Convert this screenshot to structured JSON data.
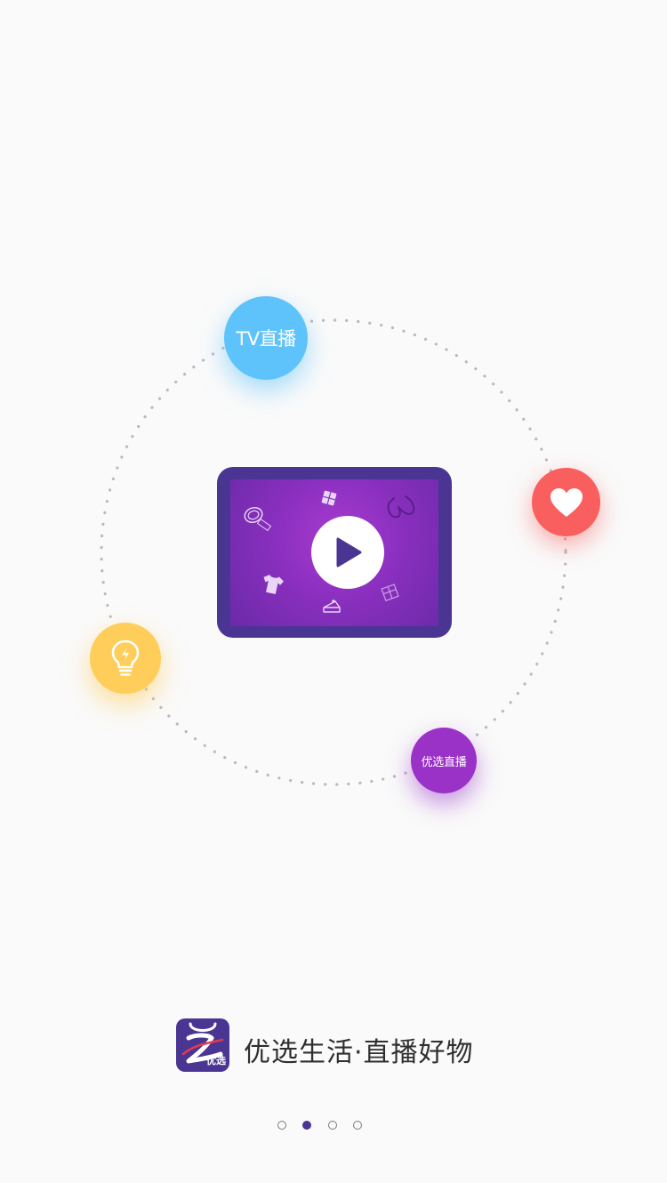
{
  "bubbles": {
    "tv_live": "TV直播",
    "selected_live": "优选直播"
  },
  "icons": {
    "heart": "heart-icon",
    "bulb": "lightbulb-icon",
    "play": "play-icon"
  },
  "logo": {
    "tag": "优选"
  },
  "slogan": "优选生活·直播好物",
  "pagination": {
    "total": 4,
    "active_index": 1
  },
  "colors": {
    "brand_purple": "#4b3593",
    "tv_bubble": "#5fc3fb",
    "heart_bubble": "#f95f5f",
    "bulb_bubble": "#ffcd5a",
    "live_bubble": "#9a32c8"
  }
}
